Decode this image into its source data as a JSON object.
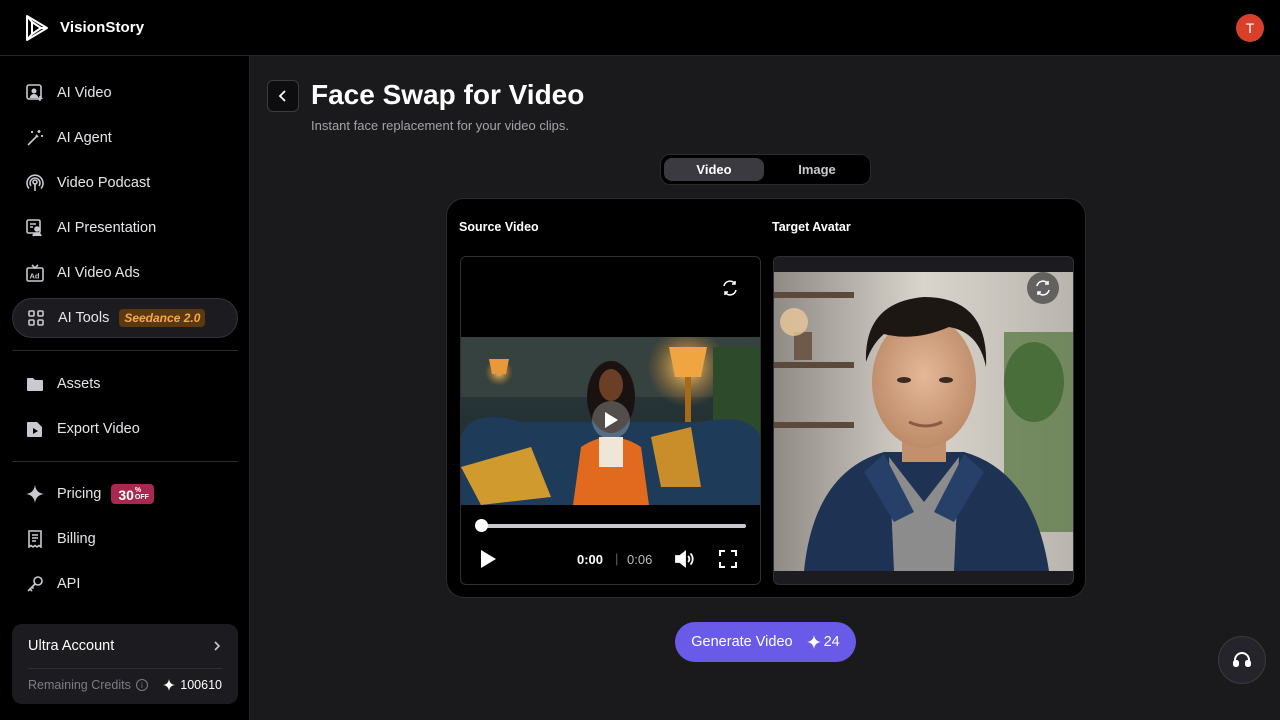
{
  "app": {
    "name": "VisionStory",
    "user_initial": "T"
  },
  "sidebar": {
    "items": [
      {
        "label": "AI Video",
        "icon": "ai-video-icon"
      },
      {
        "label": "AI Agent",
        "icon": "magic-wand-icon"
      },
      {
        "label": "Video Podcast",
        "icon": "podcast-icon"
      },
      {
        "label": "AI Presentation",
        "icon": "presentation-icon"
      },
      {
        "label": "AI Video Ads",
        "icon": "ads-icon"
      },
      {
        "label": "AI Tools",
        "icon": "grid-icon",
        "badge": "Seedance 2.0"
      },
      {
        "label": "Assets",
        "icon": "folder-icon"
      },
      {
        "label": "Export Video",
        "icon": "export-icon"
      },
      {
        "label": "Pricing",
        "icon": "sparkle-icon",
        "badge": "30",
        "badge_sup": "%",
        "badge_sub": "OFF"
      },
      {
        "label": "Billing",
        "icon": "receipt-icon"
      },
      {
        "label": "API",
        "icon": "key-icon"
      }
    ],
    "account": {
      "title": "Ultra Account",
      "credits_label": "Remaining Credits",
      "credits_value": "100610"
    }
  },
  "page": {
    "title": "Face Swap for Video",
    "subtitle": "Instant face replacement for your video clips."
  },
  "toggle": {
    "options": [
      "Video",
      "Image"
    ],
    "selected": "Video"
  },
  "panel": {
    "source_label": "Source Video",
    "target_label": "Target Avatar",
    "time_current": "0:00",
    "time_separator": "|",
    "time_total": "0:06",
    "progress": 0
  },
  "generate": {
    "label": "Generate Video",
    "cost": "24"
  },
  "colors": {
    "accent": "#6a5ae8",
    "avatar": "#d9402a",
    "seedance_badge": "#f6a945",
    "discount_badge": "#a8284f"
  }
}
